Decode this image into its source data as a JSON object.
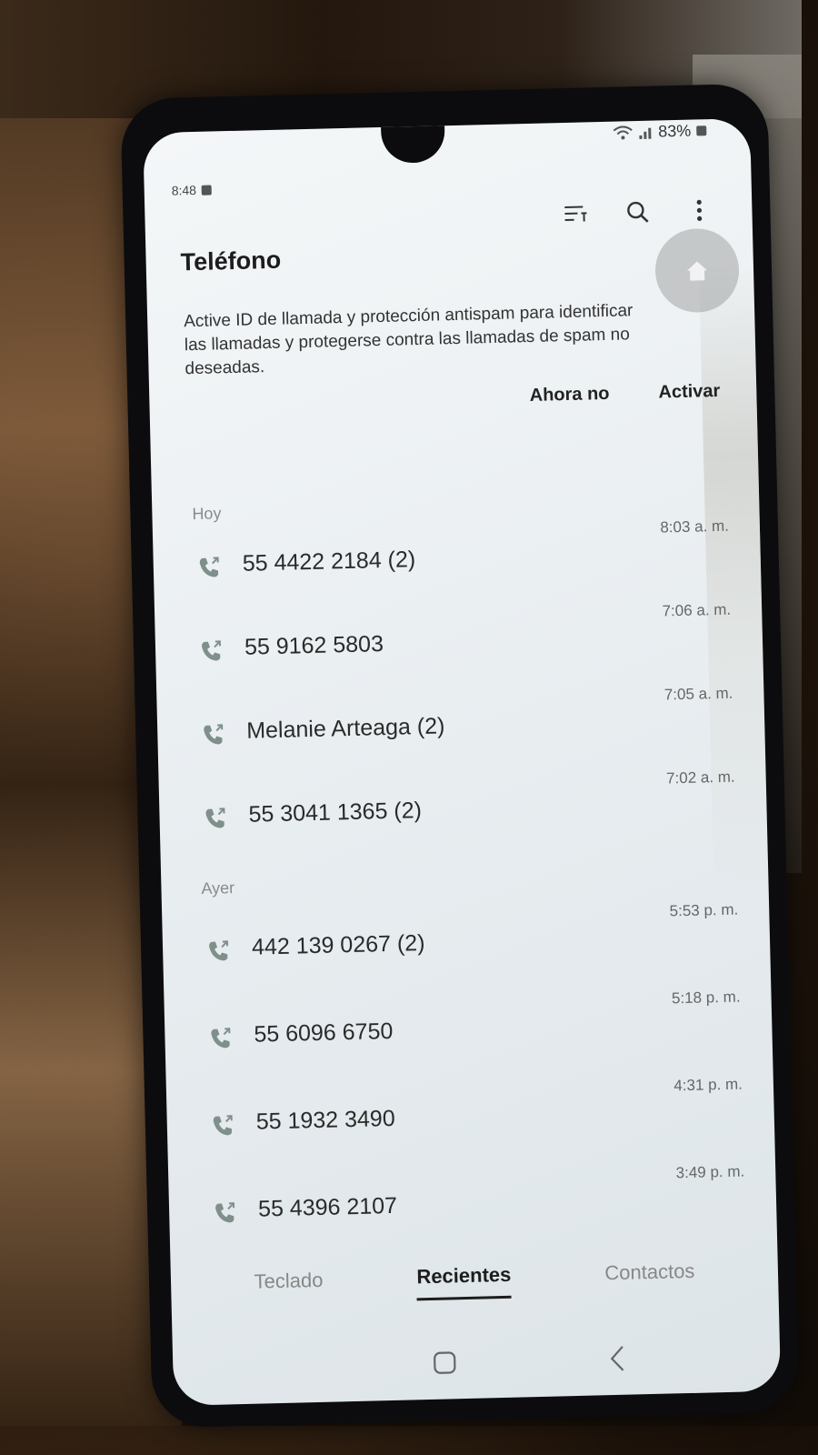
{
  "status_bar": {
    "time": "8:48",
    "battery": "83%"
  },
  "app": {
    "title": "Teléfono"
  },
  "banner": {
    "message": "Active ID de llamada y protección antispam para identificar las llamadas y protegerse contra las llamadas de spam no deseadas.",
    "dismiss_label": "Ahora no",
    "activate_label": "Activar"
  },
  "sections": {
    "today_label": "Hoy",
    "yesterday_label": "Ayer"
  },
  "calls_today": [
    {
      "name": "55 4422 2184 (2)",
      "time": "8:03 a. m."
    },
    {
      "name": "55 9162 5803",
      "time": "7:06 a. m."
    },
    {
      "name": "Melanie Arteaga (2)",
      "time": "7:05 a. m."
    },
    {
      "name": "55 3041 1365 (2)",
      "time": "7:02 a. m."
    }
  ],
  "calls_yesterday": [
    {
      "name": "442 139 0267 (2)",
      "time": "5:53 p. m."
    },
    {
      "name": "55 6096 6750",
      "time": "5:18 p. m."
    },
    {
      "name": "55 1932 3490",
      "time": "4:31 p. m."
    },
    {
      "name": "55 4396 2107",
      "time": "3:49 p. m."
    }
  ],
  "tabs": [
    {
      "label": "Teclado",
      "active": false
    },
    {
      "label": "Recientes",
      "active": true
    },
    {
      "label": "Contactos",
      "active": false
    }
  ],
  "icons": {
    "call": "outgoing-call-icon",
    "filter": "filter-icon",
    "search": "search-icon",
    "more": "more-vertical-icon",
    "home": "home-icon"
  },
  "colors": {
    "call_icon": "#7f8f8a",
    "active_tab": "#1d1d1d"
  }
}
